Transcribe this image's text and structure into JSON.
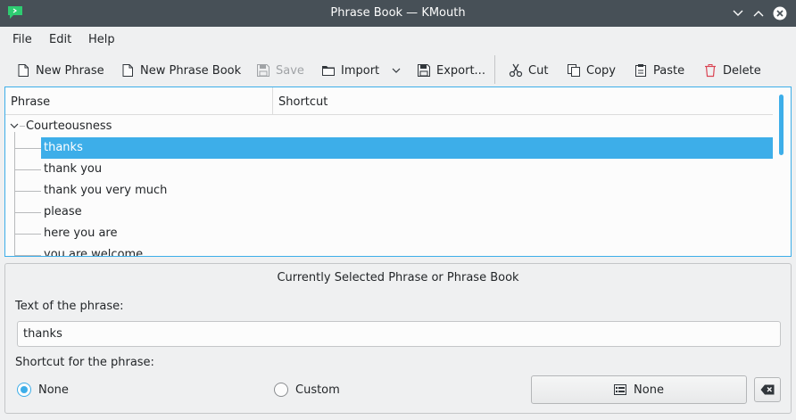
{
  "window": {
    "title": "Phrase Book — KMouth",
    "app_icon": "kmouth-speech-bubble-icon",
    "controls": [
      "minimize-icon",
      "maximize-icon",
      "close-icon"
    ]
  },
  "menubar": {
    "items": [
      {
        "label": "File"
      },
      {
        "label": "Edit"
      },
      {
        "label": "Help"
      }
    ]
  },
  "toolbar": {
    "new_phrase": "New Phrase",
    "new_phrase_book": "New Phrase Book",
    "save": "Save",
    "import": "Import",
    "export": "Export...",
    "cut": "Cut",
    "copy": "Copy",
    "paste": "Paste",
    "delete": "Delete"
  },
  "tree": {
    "columns": [
      "Phrase",
      "Shortcut"
    ],
    "group": "Courteousness",
    "items": [
      {
        "phrase": "thanks",
        "shortcut": "",
        "selected": true
      },
      {
        "phrase": "thank you",
        "shortcut": ""
      },
      {
        "phrase": "thank you very much",
        "shortcut": ""
      },
      {
        "phrase": "please",
        "shortcut": ""
      },
      {
        "phrase": "here you are",
        "shortcut": ""
      },
      {
        "phrase": "you are welcome",
        "shortcut": ""
      }
    ]
  },
  "details": {
    "group_title": "Currently Selected Phrase or Phrase Book",
    "text_label": "Text of the phrase:",
    "text_value": "thanks",
    "shortcut_label": "Shortcut for the phrase:",
    "radio_none": "None",
    "radio_custom": "Custom",
    "selected_radio": "none",
    "shortcut_button": "None"
  },
  "colors": {
    "accent": "#3daee9",
    "titlebar": "#475057",
    "window_bg": "#eff0f1",
    "delete_red": "#da4453"
  }
}
